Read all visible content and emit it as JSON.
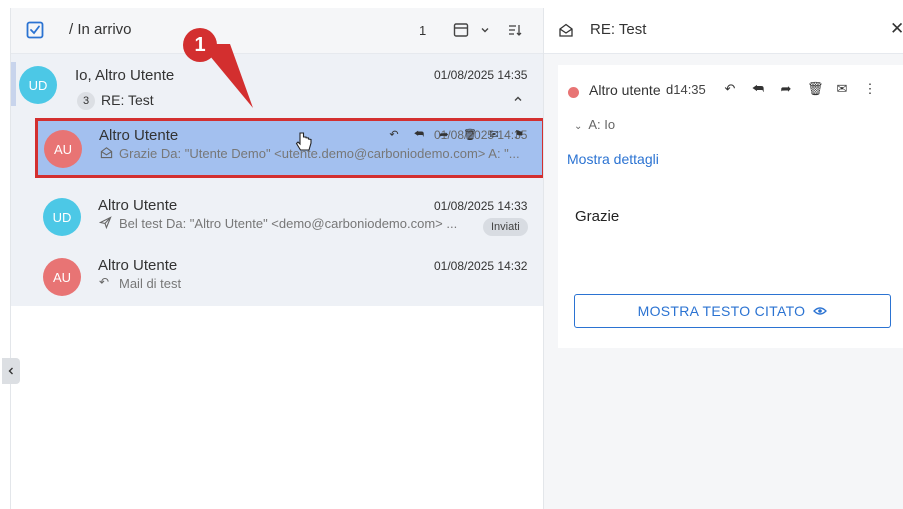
{
  "list": {
    "breadcrumb": "/ In arrivo",
    "count": "1"
  },
  "conversation": {
    "avatar": "UD",
    "participants": "Io, Altro Utente",
    "date": "01/08/2025 14:35",
    "message_count": "3",
    "subject": "RE: Test"
  },
  "messages": [
    {
      "avatar": "AU",
      "name": "Altro Utente",
      "date": "01/08/2025 14:35",
      "snippet": "Grazie Da: \"Utente Demo\" <utente.demo@carboniodemo.com> A: \"...",
      "icon": "envelope-open-icon"
    },
    {
      "avatar": "UD",
      "name": "Altro Utente",
      "date": "01/08/2025 14:33",
      "snippet": "Bel test Da: \"Altro Utente\" <demo@carboniodemo.com> ...",
      "badge": "Inviati",
      "icon": "send-icon"
    },
    {
      "avatar": "AU",
      "name": "Altro Utente",
      "date": "01/08/2025 14:32",
      "snippet": "Mail di test",
      "icon": "reply-icon"
    }
  ],
  "reader": {
    "subject": "RE: Test",
    "sender": "Altro utente",
    "time_prefix": "d",
    "time": "14:35",
    "to_line": "A: Io",
    "details_link": "Mostra dettagli",
    "body": "Grazie",
    "quote_button": "MOSTRA TESTO CITATO"
  },
  "callout": {
    "number": "1",
    "color": "#d32f2f"
  },
  "colors": {
    "accent_blue": "#2b73d2",
    "selected_row": "#a3c0ef",
    "avatar_ud": "#4cc8e6",
    "avatar_au": "#e87474"
  }
}
